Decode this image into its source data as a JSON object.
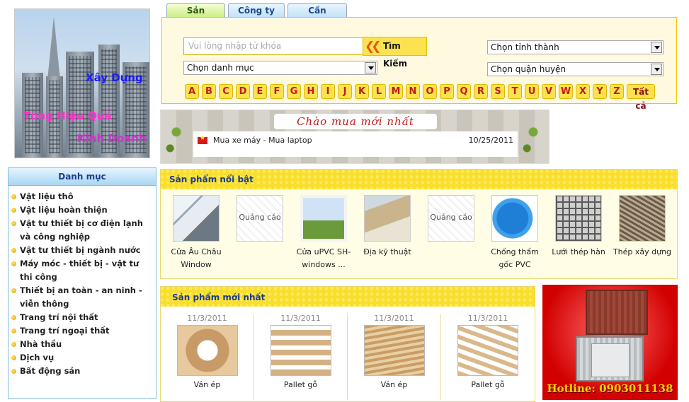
{
  "banner": {
    "line1": "Xây Dựng",
    "line2": "Tổng Hiệu Quả",
    "line3": "Kinh Doanh"
  },
  "tabs": [
    {
      "label": "Sản phẩm",
      "active": true
    },
    {
      "label": "Công ty",
      "active": false
    },
    {
      "label": "Cần mua",
      "active": false
    }
  ],
  "search": {
    "keyword_placeholder": "Vui lòng nhập từ khóa",
    "button_label": "Tìm Kiếm",
    "category_select": "Chọn danh mục",
    "province_select": "Chọn tỉnh thành",
    "district_select": "Chọn quận huyện",
    "letters": [
      "A",
      "B",
      "C",
      "D",
      "E",
      "F",
      "G",
      "H",
      "I",
      "J",
      "K",
      "L",
      "M",
      "N",
      "O",
      "P",
      "Q",
      "R",
      "S",
      "T",
      "U",
      "V",
      "W",
      "X",
      "Y",
      "Z"
    ],
    "all_label": "Tất cả"
  },
  "latest_buy": {
    "title": "Chào mua mới nhất",
    "items": [
      {
        "text": "Mua xe máy - Mua laptop",
        "date": "10/25/2011"
      }
    ]
  },
  "categories": {
    "heading": "Danh mục",
    "items": [
      "Vật liệu thô",
      "Vật liệu hoàn thiện",
      "Vật tư thiết bị cơ điện lạnh và công nghiệp",
      "Vật tư thiết bị ngành nước",
      "Máy móc - thiết bị - vật tư thi công",
      "Thiết bị an toàn - an ninh - viễn thông",
      "Trang trí nội thất",
      "Trang trí ngoại thất",
      "Nhà thầu",
      "Dịch vụ",
      "Bất động sản"
    ]
  },
  "featured": {
    "heading": "Sản phẩm nổi bật",
    "products": [
      {
        "name": "Cửa Âu Châu Window",
        "thumb_label": ""
      },
      {
        "name": "",
        "thumb_label": "Quảng cáo"
      },
      {
        "name": "Cửa uPVC SH-windows ...",
        "thumb_label": ""
      },
      {
        "name": "Địa kỹ thuật",
        "thumb_label": ""
      },
      {
        "name": "",
        "thumb_label": "Quảng cáo"
      },
      {
        "name": "Chống thấm gốc PVC",
        "thumb_label": ""
      },
      {
        "name": "Lưới thép hàn",
        "thumb_label": ""
      },
      {
        "name": "Thép xây dựng",
        "thumb_label": ""
      }
    ]
  },
  "newest": {
    "heading": "Sản phẩm mới nhất",
    "products": [
      {
        "date": "11/3/2011",
        "name": "Ván ép"
      },
      {
        "date": "11/3/2011",
        "name": "Pallet gỗ"
      },
      {
        "date": "11/3/2011",
        "name": "Ván ép"
      },
      {
        "date": "11/3/2011",
        "name": "Pallet gỗ"
      }
    ]
  },
  "ad": {
    "hotline": "Hotline: 0903011138"
  }
}
